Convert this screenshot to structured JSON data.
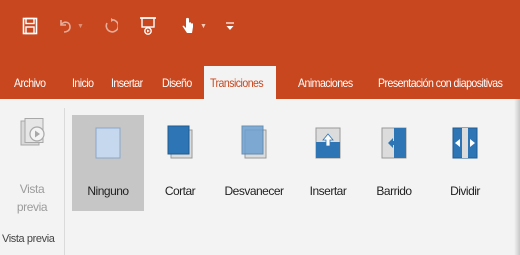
{
  "quick_access": {
    "save_icon": "save-icon",
    "undo_icon": "undo-icon",
    "redo_icon": "redo-icon",
    "present_icon": "present-from-start-icon",
    "touch_icon": "touch-mouse-mode-icon",
    "customize_icon": "customize-toolbar-icon"
  },
  "tabs": [
    "Archivo",
    "Inicio",
    "Insertar",
    "Diseño",
    "Transiciones",
    "Animaciones",
    "Presentación con diapositivas"
  ],
  "active_tab": "Transiciones",
  "preview_group": {
    "button_line1": "Vista",
    "button_line2": "previa",
    "group_label": "Vista previa"
  },
  "transitions": [
    {
      "label": "Ninguno",
      "selected": true
    },
    {
      "label": "Cortar",
      "selected": false
    },
    {
      "label": "Desvanecer",
      "selected": false
    },
    {
      "label": "Insertar",
      "selected": false
    },
    {
      "label": "Barrido",
      "selected": false
    },
    {
      "label": "Dividir",
      "selected": false
    }
  ],
  "colors": {
    "accent": "#c8471f",
    "ribbon_bg": "#f3f3f3",
    "selected_bg": "#c6c6c6",
    "slide_blue": "#2e75b6"
  }
}
